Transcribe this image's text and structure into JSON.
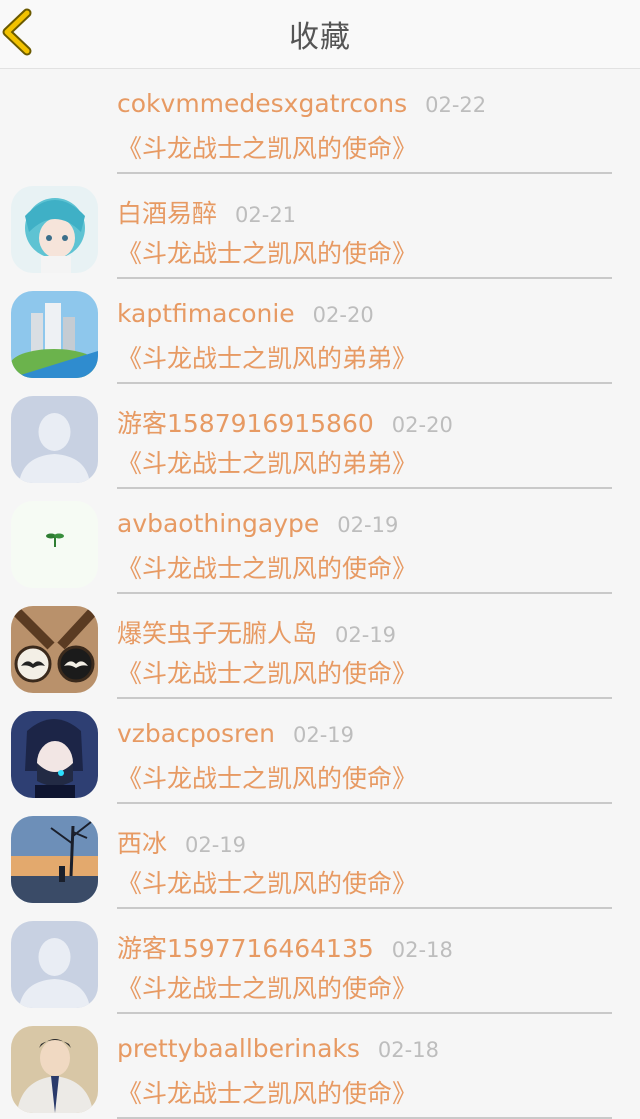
{
  "header": {
    "title": "收藏",
    "back_icon": "chevron-left-icon",
    "accent_color": "#e7b400"
  },
  "colors": {
    "name": "#e79a63",
    "date": "#bdbdbd",
    "book": "#e79a63"
  },
  "favorites": [
    {
      "name": "cokvmmedesxgatrcons",
      "date": "02-22",
      "book": "《斗龙战士之凯风的使命》",
      "avatar": "none"
    },
    {
      "name": "白酒易醉",
      "date": "02-21",
      "book": "《斗龙战士之凯风的使命》",
      "avatar": "anime-girl-teal"
    },
    {
      "name": "kaptfimaconie",
      "date": "02-20",
      "book": "《斗龙战士之凯风的弟弟》",
      "avatar": "city-buildings"
    },
    {
      "name": "游客1587916915860",
      "date": "02-20",
      "book": "《斗龙战士之凯风的弟弟》",
      "avatar": "default-person"
    },
    {
      "name": "avbaothingaype",
      "date": "02-19",
      "book": "《斗龙战士之凯风的使命》",
      "avatar": "sprout"
    },
    {
      "name": "爆笑虫子无腑人岛",
      "date": "02-19",
      "book": "《斗龙战士之凯风的使命》",
      "avatar": "mustache-pendants"
    },
    {
      "name": "vzbacposren",
      "date": "02-19",
      "book": "《斗龙战士之凯风的使命》",
      "avatar": "anime-boy-headphones"
    },
    {
      "name": "西冰",
      "date": "02-19",
      "book": "《斗龙战士之凯风的使命》",
      "avatar": "sunset-tree"
    },
    {
      "name": "游客1597716464135",
      "date": "02-18",
      "book": "《斗龙战士之凯风的使命》",
      "avatar": "default-person"
    },
    {
      "name": "prettybaallberinaks",
      "date": "02-18",
      "book": "《斗龙战士之凯风的使命》",
      "avatar": "boy-jacket"
    }
  ]
}
